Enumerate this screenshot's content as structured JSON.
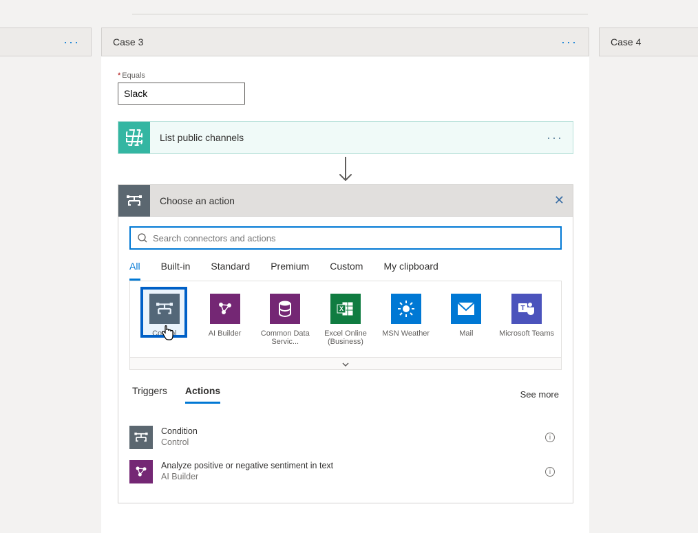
{
  "cases": {
    "center_title": "Case 3",
    "right_title": "Case 4"
  },
  "field": {
    "label": "Equals",
    "value": "Slack"
  },
  "action_step": {
    "label": "List public channels"
  },
  "chooser": {
    "title": "Choose an action",
    "search_placeholder": "Search connectors and actions",
    "category_tabs": [
      "All",
      "Built-in",
      "Standard",
      "Premium",
      "Custom",
      "My clipboard"
    ],
    "active_cat": 0,
    "connectors": [
      {
        "key": "control",
        "label": "Control"
      },
      {
        "key": "ai",
        "label": "AI Builder"
      },
      {
        "key": "cds",
        "label": "Common Data Servic..."
      },
      {
        "key": "excel",
        "label": "Excel Online (Business)"
      },
      {
        "key": "msn",
        "label": "MSN Weather"
      },
      {
        "key": "mail",
        "label": "Mail"
      },
      {
        "key": "teams",
        "label": "Microsoft Teams"
      }
    ],
    "sub_tabs": [
      "Triggers",
      "Actions"
    ],
    "active_sub": 1,
    "see_more": "See more",
    "actions": [
      {
        "icon": "control",
        "title": "Condition",
        "subtitle": "Control"
      },
      {
        "icon": "ai",
        "title": "Analyze positive or negative sentiment in text",
        "subtitle": "AI Builder"
      }
    ]
  }
}
